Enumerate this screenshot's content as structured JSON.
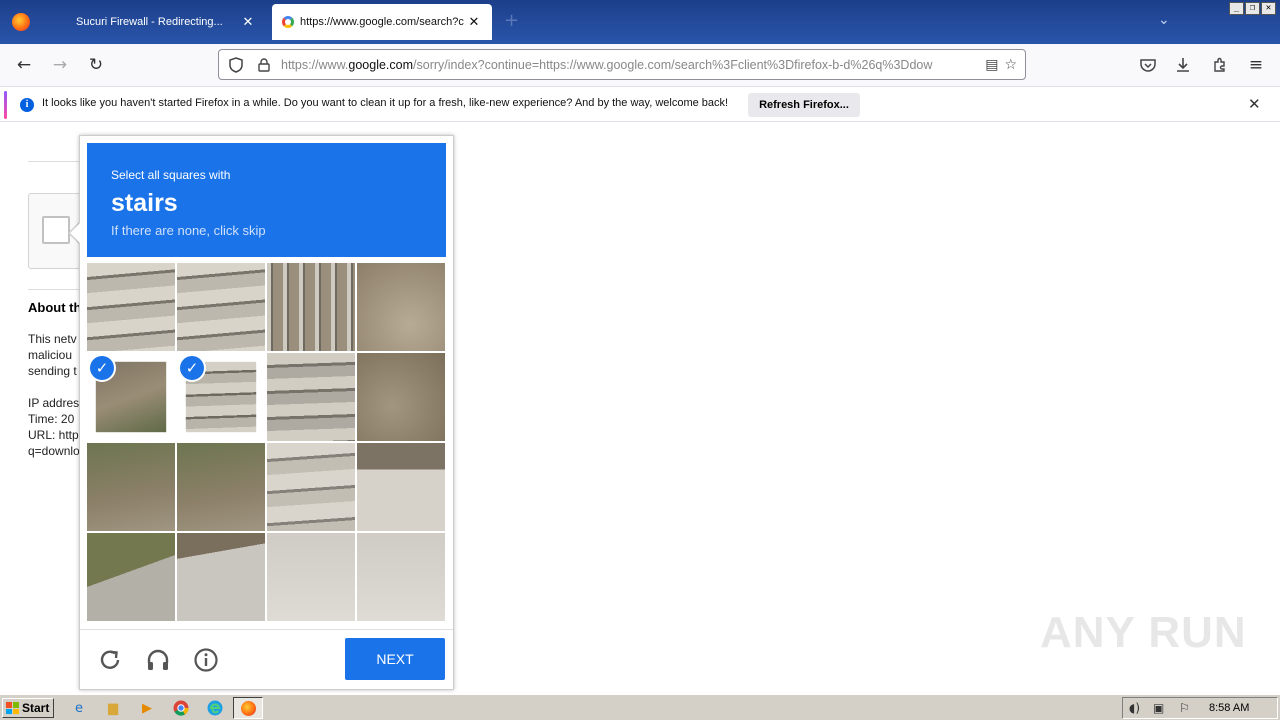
{
  "browser": {
    "tabs": [
      {
        "title": "Sucuri Firewall - Redirecting...",
        "active": false
      },
      {
        "title": "https://www.google.com/search?c",
        "active": true
      }
    ],
    "new_tab_symbol": "+",
    "url": {
      "prefix": "https://www.",
      "domain": "google.com",
      "rest": "/sorry/index?continue=https://www.google.com/search%3Fclient%3Dfirefox-b-d%26q%3Ddow"
    }
  },
  "notification": {
    "text": "It looks like you haven't started Firefox in a while. Do you want to clean it up for a fresh, like-new experience? And by the way, welcome back!",
    "button": "Refresh Firefox..."
  },
  "background_page": {
    "heading": "About th",
    "lines": [
      "This netv",
      "maliciou",
      "sending t",
      "IP addres",
      "Time: 20",
      "URL: http",
      "q=downlo"
    ]
  },
  "captcha": {
    "instruction": "Select all squares with",
    "keyword": "stairs",
    "hint": "If there are none, click skip",
    "tiles": [
      {
        "index": 0,
        "selected": false
      },
      {
        "index": 1,
        "selected": false
      },
      {
        "index": 2,
        "selected": false
      },
      {
        "index": 3,
        "selected": false
      },
      {
        "index": 4,
        "selected": true
      },
      {
        "index": 5,
        "selected": true
      },
      {
        "index": 6,
        "selected": false
      },
      {
        "index": 7,
        "selected": false
      },
      {
        "index": 8,
        "selected": false
      },
      {
        "index": 9,
        "selected": false
      },
      {
        "index": 10,
        "selected": false
      },
      {
        "index": 11,
        "selected": false
      },
      {
        "index": 12,
        "selected": false
      },
      {
        "index": 13,
        "selected": false
      },
      {
        "index": 14,
        "selected": false
      },
      {
        "index": 15,
        "selected": false
      }
    ],
    "next_button": "NEXT",
    "accent_color": "#1a73e8"
  },
  "watermark": "ANY RUN",
  "taskbar": {
    "start_label": "Start",
    "clock": "8:58 AM"
  }
}
